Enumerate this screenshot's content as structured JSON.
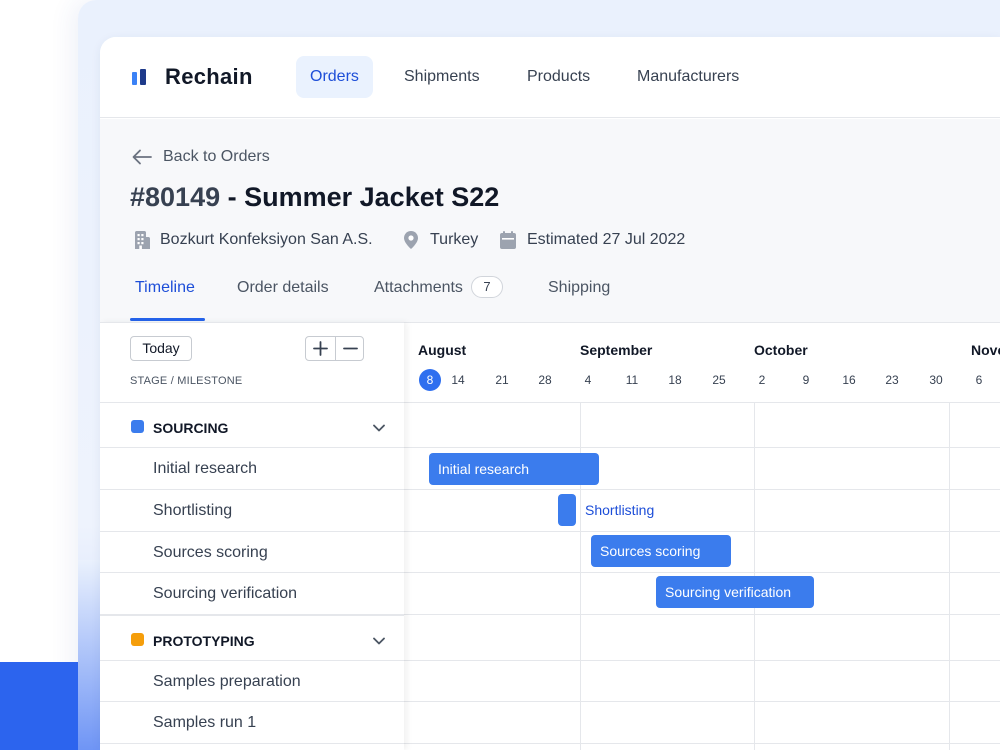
{
  "app": {
    "brand": "Rechain",
    "nav": [
      "Orders",
      "Shipments",
      "Products",
      "Manufacturers"
    ],
    "active_nav": "Orders"
  },
  "order": {
    "back_label": "Back to Orders",
    "number": "#80149",
    "separator": " - ",
    "name": "Summer Jacket S22",
    "manufacturer": "Bozkurt Konfeksiyon San A.S.",
    "country": "Turkey",
    "estimated": "Estimated 27 Jul 2022"
  },
  "tabs": {
    "timeline": "Timeline",
    "order_details": "Order details",
    "attachments": "Attachments",
    "attachments_count": "7",
    "shipping": "Shipping",
    "active": "Timeline"
  },
  "toolbar": {
    "today_label": "Today",
    "column_label": "STAGE / MILESTONE"
  },
  "timeline": {
    "months": [
      "August",
      "September",
      "October",
      "Nove"
    ],
    "days": [
      "8",
      "14",
      "21",
      "28",
      "4",
      "11",
      "18",
      "25",
      "2",
      "9",
      "16",
      "23",
      "30",
      "6"
    ],
    "today_day": "8"
  },
  "stages": [
    {
      "name": "SOURCING",
      "color": "#3b7ced",
      "milestones": [
        {
          "label": "Initial research",
          "bar_label": "Initial research"
        },
        {
          "label": "Shortlisting",
          "bar_label": "Shortlisting"
        },
        {
          "label": "Sources scoring",
          "bar_label": "Sources scoring"
        },
        {
          "label": "Sourcing verification",
          "bar_label": "Sourcing verification"
        }
      ]
    },
    {
      "name": "PROTOTYPING",
      "color": "#f59e0b",
      "milestones": [
        {
          "label": "Samples preparation"
        },
        {
          "label": "Samples run 1"
        }
      ]
    }
  ],
  "colors": {
    "accent": "#2563eb",
    "bar": "#3b7ced",
    "nav_active_bg": "#eaf2fe"
  }
}
